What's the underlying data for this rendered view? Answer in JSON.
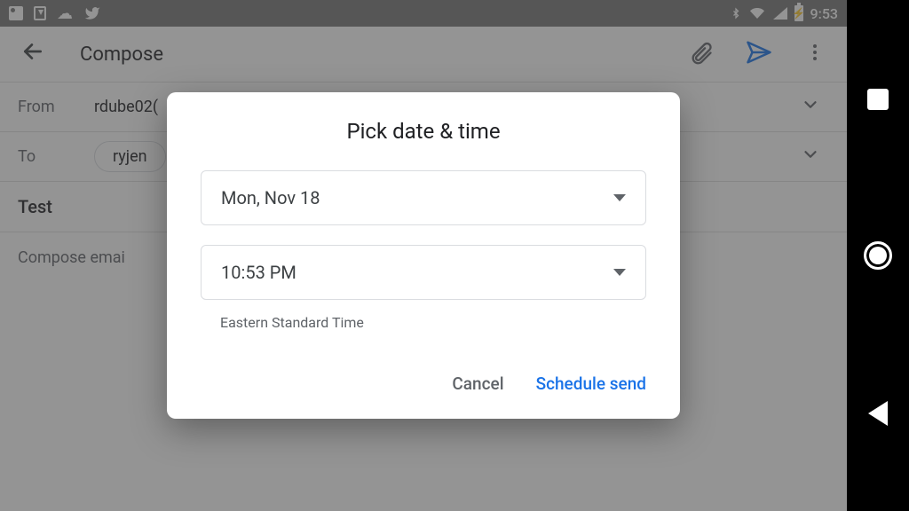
{
  "status_bar": {
    "time": "9:53"
  },
  "appbar": {
    "title": "Compose"
  },
  "compose": {
    "from_label": "From",
    "from_value": "rdube02(",
    "to_label": "To",
    "to_chip": "ryjen",
    "subject": "Test",
    "body_placeholder": "Compose emai"
  },
  "dialog": {
    "title": "Pick date & time",
    "date": "Mon, Nov 18",
    "time": "10:53 PM",
    "timezone": "Eastern Standard Time",
    "cancel": "Cancel",
    "confirm": "Schedule send"
  }
}
